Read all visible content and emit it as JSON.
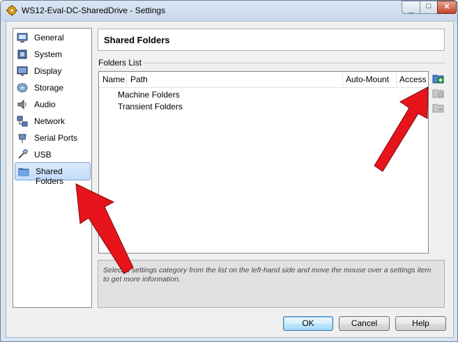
{
  "window": {
    "title": "WS12-Eval-DC-SharedDrive - Settings",
    "title_icon": "gear-icon",
    "controls": {
      "minimize": "_",
      "maximize": "□",
      "close": "✕"
    }
  },
  "sidebar": {
    "items": [
      {
        "label": "General",
        "icon": "monitor-icon"
      },
      {
        "label": "System",
        "icon": "chip-icon"
      },
      {
        "label": "Display",
        "icon": "display-icon"
      },
      {
        "label": "Storage",
        "icon": "disk-icon"
      },
      {
        "label": "Audio",
        "icon": "speaker-icon"
      },
      {
        "label": "Network",
        "icon": "network-icon"
      },
      {
        "label": "Serial Ports",
        "icon": "serial-port-icon"
      },
      {
        "label": "USB",
        "icon": "usb-icon"
      },
      {
        "label": "Shared Folders",
        "icon": "folder-icon",
        "selected": true
      }
    ]
  },
  "main": {
    "page_title": "Shared Folders",
    "folders_list": {
      "label": "Folders List",
      "columns": [
        "Name",
        "Path",
        "Auto-Mount",
        "Access"
      ],
      "rows": [
        "Machine Folders",
        "Transient Folders"
      ]
    },
    "tools": [
      {
        "name": "add-shared-folder-button",
        "icon": "add-folder-icon",
        "enabled": true
      },
      {
        "name": "edit-shared-folder-button",
        "icon": "edit-folder-icon",
        "enabled": false
      },
      {
        "name": "remove-shared-folder-button",
        "icon": "remove-folder-icon",
        "enabled": false
      }
    ],
    "info_text": "Select a settings category from the list on the left-hand side and move the mouse over a settings item to get more information."
  },
  "buttons": {
    "ok": "OK",
    "cancel": "Cancel",
    "help": "Help"
  },
  "annotation_arrows": {
    "color": "#e8141b"
  }
}
